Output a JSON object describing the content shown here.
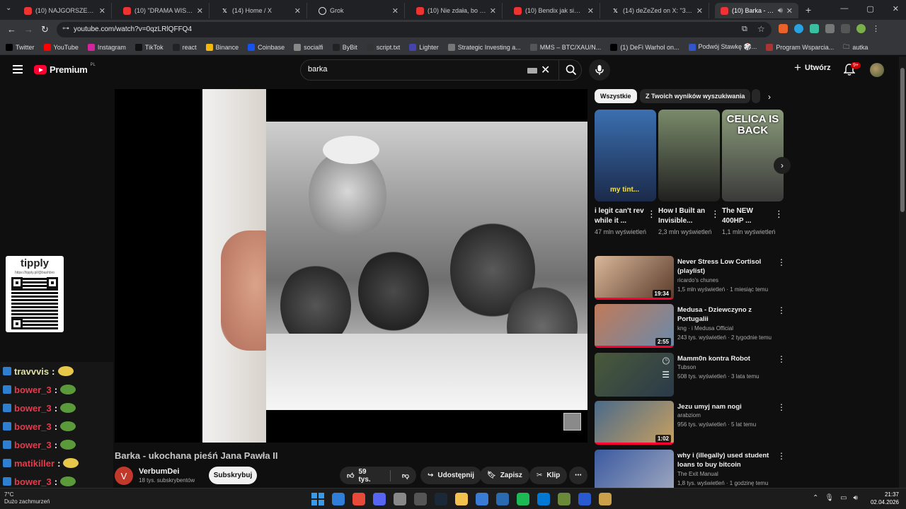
{
  "browser": {
    "tabs": [
      {
        "title": "(10) NAJGORSZE SILNIKI",
        "icon": "youtube-icon"
      },
      {
        "title": "(10) \"DRAMA WISI W POW",
        "icon": "youtube-icon"
      },
      {
        "title": "(14) Home / X",
        "icon": "x-icon"
      },
      {
        "title": "Grok",
        "icon": "grok-icon"
      },
      {
        "title": "(10) Nie zdała, bo nie jechał",
        "icon": "youtube-icon"
      },
      {
        "title": "(10) Bendix jak się zachowuje",
        "icon": "youtube-icon"
      },
      {
        "title": "(14) deZeZed on X: \"34-latek",
        "icon": "x-icon"
      },
      {
        "title": "(10) Barka - ukochana",
        "icon": "youtube-icon",
        "active": true
      }
    ],
    "url": "youtube.com/watch?v=0qzLRlQFFQ4",
    "bookmarks": [
      {
        "label": "Twitter",
        "color": "#000000"
      },
      {
        "label": "YouTube",
        "color": "#ff0000"
      },
      {
        "label": "Instagram",
        "color": "#d6249f"
      },
      {
        "label": "TikTok",
        "color": "#111111"
      },
      {
        "label": "react",
        "color": "#222222"
      },
      {
        "label": "Binance",
        "color": "#f0b90b"
      },
      {
        "label": "Coinbase",
        "color": "#1652f0"
      },
      {
        "label": "socialfi",
        "color": "#888888"
      },
      {
        "label": "ByBit",
        "color": "#222222"
      },
      {
        "label": "script.txt",
        "color": "#333333"
      },
      {
        "label": "Lighter",
        "color": "#4444aa"
      },
      {
        "label": "Strategic Investing a...",
        "color": "#777777"
      },
      {
        "label": "MMS – BTC/XAU/N...",
        "color": "#555555"
      },
      {
        "label": "(1) DeFi Warhol on...",
        "color": "#000000"
      },
      {
        "label": "Podwój Stawkę 🎲...",
        "color": "#3355cc"
      },
      {
        "label": "Program Wsparcia...",
        "color": "#aa3333"
      }
    ],
    "bookmark_folder": "autka"
  },
  "header": {
    "brand": "Premium",
    "country": "PL",
    "search_value": "barka",
    "create_label": "Utwórz",
    "notification_badge": "9+"
  },
  "overlay": {
    "tippy_title": "tipply",
    "tippy_sub": "https://tipply.pl/@bashbro",
    "chat": [
      {
        "user": "travvvis",
        "color": "green",
        "emote": "emote-yellow"
      },
      {
        "user": "bower_3",
        "color": "red",
        "emote": "emote-frog"
      },
      {
        "user": "bower_3",
        "color": "red",
        "emote": "emote-frog"
      },
      {
        "user": "bower_3",
        "color": "red",
        "emote": "emote-frog"
      },
      {
        "user": "bower_3",
        "color": "red",
        "emote": "emote-frog"
      },
      {
        "user": "matikiller",
        "color": "red",
        "emote": "emote-yellow"
      },
      {
        "user": "bower_3",
        "color": "red",
        "emote": "emote-frog"
      }
    ]
  },
  "video": {
    "title": "Barka - ukochana pieśń Jana Pawła II",
    "channel": "VerbumDei",
    "channel_initial": "V",
    "subscribers": "18 tys. subskrybentów",
    "subscribe_label": "Subskrybuj",
    "likes": "59 tys.",
    "share_label": "Udostępnij",
    "save_label": "Zapisz",
    "clip_label": "Klip"
  },
  "chips": [
    "Wszystkie",
    "Z Twoich wyników wyszukiwania"
  ],
  "shorts": [
    {
      "title": "i legit can't rev while it ...",
      "views": "47 mln wyświetleń",
      "caption": "my tint...",
      "bg1": "#3b6fb0",
      "bg2": "#1b2a4a"
    },
    {
      "title": "How I Built an Invisible...",
      "views": "2,3 mln wyświetleń",
      "caption": "",
      "bg1": "#7a8a6a",
      "bg2": "#202020"
    },
    {
      "title": "The NEW 400HP ...",
      "views": "1,1 mln wyświetleń",
      "caption": "CELICA IS BACK",
      "bg1": "#8a9a7a",
      "bg2": "#3a3a3a"
    }
  ],
  "recommendations": [
    {
      "title": "Never Stress Low Cortisol (playlist)",
      "channel": "ricardo's chunes",
      "meta": "1,5 mln wyświetleń · 1 miesiąc temu",
      "duration": "19:34",
      "progress": 1.0,
      "bg1": "#d9b89a",
      "bg2": "#5a3a2a"
    },
    {
      "title": "Medusa - Dziewczyno z Portugalii",
      "channel": "kng · i Medusa Official",
      "meta": "243 tys. wyświetleń · 2 tygodnie temu",
      "duration": "2:55",
      "progress": 1.0,
      "bg1": "#c07a5a",
      "bg2": "#6a8aaa"
    },
    {
      "title": "Mamm0n kontra Robot",
      "channel": "Tubson",
      "meta": "508 tys. wyświetleń · 3 lata temu",
      "duration": "",
      "progress": 0.0,
      "bg1": "#4a5a3a",
      "bg2": "#2a3a4a"
    },
    {
      "title": "Jezu umyj nam nogi",
      "channel": "arabziom",
      "meta": "956 tys. wyświetleń · 5 lat temu",
      "duration": "1:02",
      "progress": 1.0,
      "bg1": "#4a6a8a",
      "bg2": "#c8a060"
    },
    {
      "title": "why i (illegally) used student loans to buy bitcoin",
      "channel": "The Exit Manual",
      "meta": "1,8 tys. wyświetleń · 1 godzinę temu",
      "duration": "",
      "progress": 0.0,
      "bg1": "#3a5aa0",
      "bg2": "#a0a8c0"
    }
  ],
  "taskbar": {
    "temperature": "7°C",
    "weather": "Dużo zachmurzeń",
    "time": "21:37",
    "date": "02.04.2026",
    "apps": [
      "#2f7fd8",
      "#e84a3a",
      "#5865f2",
      "#888888",
      "#555555",
      "#1b2838",
      "#f2c14e",
      "#3a7bd5",
      "#2a6ab0",
      "#1db954",
      "#0078d4",
      "#6a8a3a",
      "#2a5ad0",
      "#caa04a"
    ]
  }
}
